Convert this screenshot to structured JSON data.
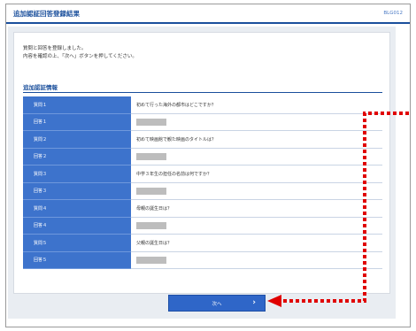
{
  "header": {
    "title": "追加認証回答登録結果",
    "screen_id": "BLG012"
  },
  "message": {
    "line1": "質問と回答を登録しました。",
    "line2": "内容を確認の上、「次へ」ボタンを押してください。"
  },
  "section": {
    "title": "追加認証情報"
  },
  "rows": [
    {
      "label": "質問１",
      "value": "初めて行った海外の都市はどこですか？",
      "masked": false
    },
    {
      "label": "回答１",
      "value": "",
      "masked": true
    },
    {
      "label": "質問２",
      "value": "初めて映画館で観た映画のタイトルは？",
      "masked": false
    },
    {
      "label": "回答２",
      "value": "",
      "masked": true
    },
    {
      "label": "質問３",
      "value": "中学３年生の担任の名前は何ですか？",
      "masked": false
    },
    {
      "label": "回答３",
      "value": "",
      "masked": true
    },
    {
      "label": "質問４",
      "value": "母親の誕生日は？",
      "masked": false
    },
    {
      "label": "回答４",
      "value": "",
      "masked": true
    },
    {
      "label": "質問５",
      "value": "父親の誕生日は？",
      "masked": false
    },
    {
      "label": "回答５",
      "value": "",
      "masked": true
    }
  ],
  "footer": {
    "next_label": "次へ"
  },
  "colors": {
    "brand": "#1a4f9c",
    "header_cell": "#3d73cc",
    "annotation": "#e00000"
  }
}
